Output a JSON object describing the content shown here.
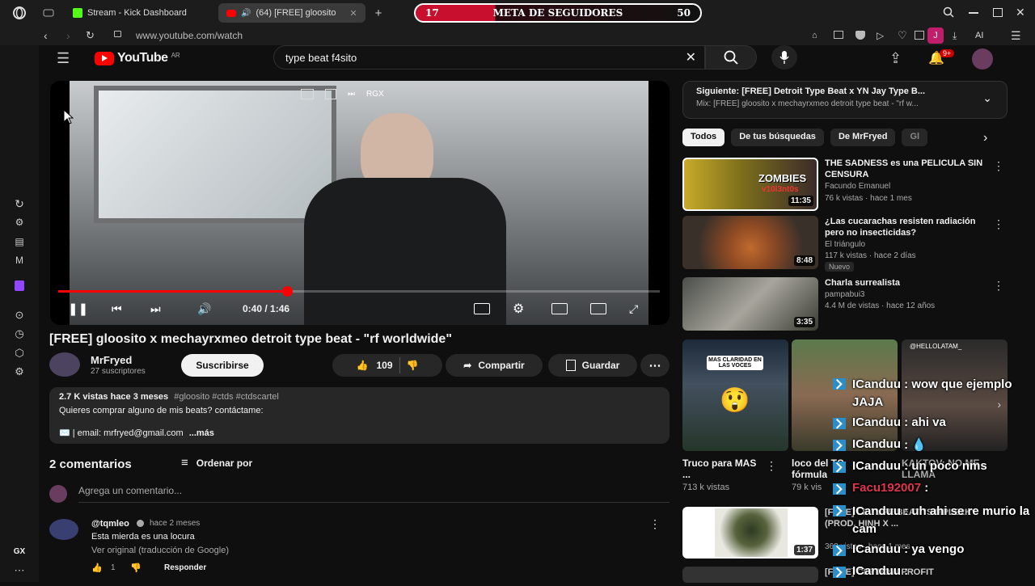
{
  "browser": {
    "tabs": [
      {
        "label": "Stream - Kick Dashboard",
        "active": false
      },
      {
        "label": "(64) [FREE] gloosito",
        "active": true
      }
    ],
    "url": "www.youtube.com/watch",
    "profile_initial": "J",
    "ai_label": "AI"
  },
  "overlay": {
    "goal_left": "17",
    "goal_title": "META DE SEGUIDORES",
    "goal_right": "50"
  },
  "youtube": {
    "logo": "YouTube",
    "country": "AR",
    "search_value": "type beat f4sito",
    "notifications": "9+"
  },
  "player": {
    "miniplayer_label": "RGX",
    "time": "0:40 / 1:46",
    "progress_fraction": 0.38
  },
  "video": {
    "title": "[FREE] gloosito x mechayrxmeo detroit type beat - \"rf worldwide\"",
    "channel": "MrFryed",
    "subscribers": "27 suscriptores",
    "subscribe_label": "Suscribirse",
    "likes": "109",
    "share_label": "Compartir",
    "save_label": "Guardar",
    "views_date": "2.7 K vistas  hace 3 meses",
    "tags": "#gloosito #ctds #ctdscartel",
    "desc_line1": "Quieres comprar alguno de mis beats? contáctame:",
    "desc_line2": "✉️ | email: mrfryed@gmail.com",
    "more": "...más"
  },
  "comments": {
    "count_label": "2 comentarios",
    "sort_label": "Ordenar por",
    "add_placeholder": "Agrega un comentario...",
    "items": [
      {
        "author": "@tqmleo",
        "time": "hace 2 meses",
        "text": "Esta mierda es una locura",
        "translate": "Ver original (traducción de Google)",
        "likes": "1",
        "reply": "Responder"
      }
    ]
  },
  "next_up": {
    "title": "Siguiente: [FREE] Detroit Type Beat x YN Jay Type B...",
    "subtitle": "Mix: [FREE] gloosito x mechayrxmeo detroit type beat - \"rf w..."
  },
  "chips": [
    "Todos",
    "De tus búsquedas",
    "De MrFryed",
    "Gl"
  ],
  "recommended": [
    {
      "title": "THE SADNESS es una PELICULA SIN CENSURA",
      "channel": "Facundo Emanuel",
      "meta": "76 k vistas · hace 1 mes",
      "duration": "11:35",
      "thumb_text": "ZOMBIES",
      "thumb_text2": "v10l3nt0s",
      "badge": ""
    },
    {
      "title": "¿Las cucarachas resisten radiación pero no insecticidas?",
      "channel": "El triángulo",
      "meta": "117 k vistas · hace 2 días",
      "duration": "8:48",
      "badge": "Nuevo"
    },
    {
      "title": "Charla surrealista",
      "channel": "pampabui3",
      "meta": "4.4 M de vistas · hace 12 años",
      "duration": "3:35",
      "badge": ""
    }
  ],
  "shorts": [
    {
      "title": "Truco para MAS ...",
      "meta": "713 k vistas",
      "thumb_text": "MAS CLARIDAD EN LAS VOCES"
    },
    {
      "title": "loco del TC fórmula",
      "meta": "79 k vis",
      "thumb_text": ""
    },
    {
      "title": "KAKTOV: NO ME LLAMA",
      "meta": "",
      "thumb_text": "@HELLOLATAM_"
    }
  ],
  "recommended_bottom": [
    {
      "title": "[FREE] LE TYPE BEAT \"SIMPLE2K\" (PROD. HINH X ...",
      "meta": "368 vistas · hace 1 mes",
      "duration": "1:37"
    },
    {
      "title": "[FREE] CFP NOW PROFIT",
      "meta": "",
      "duration": ""
    }
  ],
  "chat": [
    {
      "user": "ICanduu",
      "msg": ": wow que ejemplo JAJA",
      "user_color": "#ffffff"
    },
    {
      "user": "ICanduu",
      "msg": ": ahi va",
      "user_color": "#ffffff"
    },
    {
      "user": "ICanduu",
      "msg": ": 💧",
      "user_color": "#ffffff"
    },
    {
      "user": "ICanduu",
      "msg": ": un poco nms",
      "user_color": "#ffffff"
    },
    {
      "user": "Facu192007",
      "msg": ":",
      "user_color": "#e0344f"
    },
    {
      "user": "ICanduu",
      "msg": ": uh ahi se re murio la cam",
      "user_color": "#ffffff"
    },
    {
      "user": "ICanduu",
      "msg": ": ya vengo",
      "user_color": "#ffffff"
    },
    {
      "user": "ICanduu",
      "msg": ":",
      "user_color": "#ffffff"
    }
  ],
  "left_rail": {
    "bottom_label": "GX"
  }
}
